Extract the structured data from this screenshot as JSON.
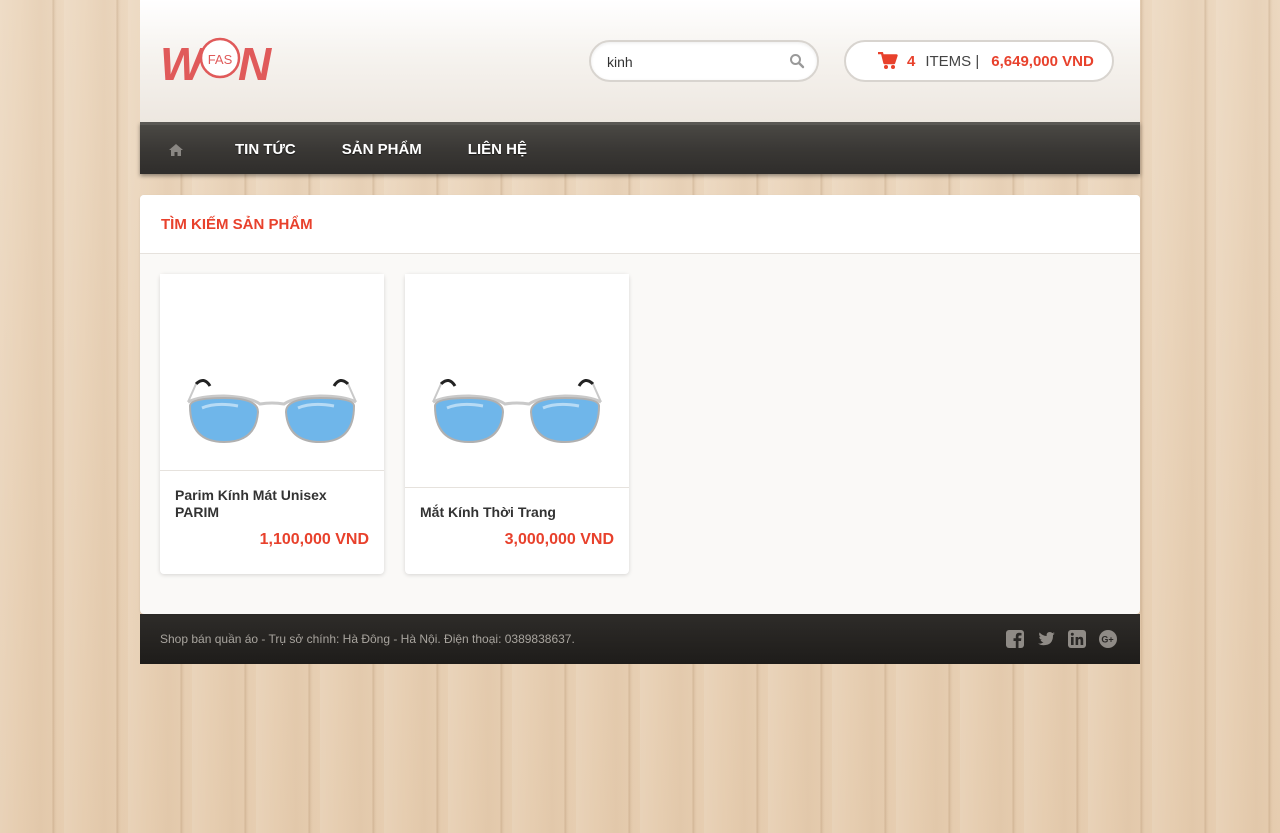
{
  "header": {
    "logo": {
      "text_left": "W",
      "text_mid": "FAS",
      "text_right": "N"
    },
    "search": {
      "value": "kinh",
      "placeholder": ""
    },
    "cart": {
      "count": "4",
      "items_label": "ITEMS |",
      "total": "6,649,000 VND"
    }
  },
  "nav": {
    "items": [
      {
        "label": "TIN TỨC"
      },
      {
        "label": "SẢN PHẨM"
      },
      {
        "label": "LIÊN HỆ"
      }
    ]
  },
  "main": {
    "title": "TÌM KIẾM SẢN PHẨM",
    "products": [
      {
        "name": "Parim Kính Mát Unisex PARIM",
        "price": "1,100,000 VND"
      },
      {
        "name": "Mắt Kính Thời Trang",
        "price": "3,000,000 VND"
      }
    ]
  },
  "footer": {
    "text": "Shop bán quần áo - Trụ sở chính: Hà Đông - Hà Nội. Điện thoại: 0389838637.",
    "social": [
      "facebook-icon",
      "twitter-icon",
      "linkedin-icon",
      "google-plus-icon"
    ]
  },
  "colors": {
    "accent": "#e8412c",
    "logo": "#e05a5a",
    "nav": "#3a3835",
    "footer": "#1e1c1a"
  }
}
